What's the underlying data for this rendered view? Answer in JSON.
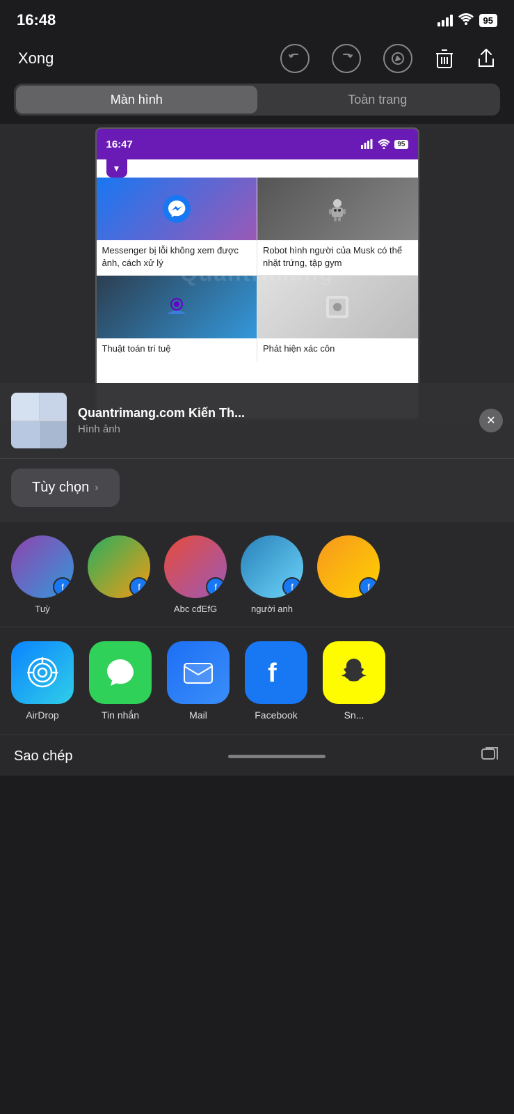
{
  "statusBar": {
    "time": "16:48",
    "batteryLevel": "95"
  },
  "toolbar": {
    "doneLabel": "Xong",
    "undoIcon": "↩",
    "redoIcon": "↪",
    "penIcon": "✏",
    "trashIcon": "🗑",
    "shareIcon": "⬆"
  },
  "segmentControl": {
    "option1": "Màn hình",
    "option2": "Toàn trang"
  },
  "screenshotPreview": {
    "innerTime": "16:47",
    "batteryInner": "95",
    "watermark": "Quantrimang"
  },
  "newsCards": [
    {
      "title": "Messenger bị lỗi không xem được ảnh, cách xử lý",
      "thumb": "messenger"
    },
    {
      "title": "Robot hình người của Musk có thể nhặt trứng, tập gym",
      "thumb": "robot"
    },
    {
      "title": "Thuật toán trí tuệ",
      "thumb": "ai"
    },
    {
      "title": "Phát hiện xác côn",
      "thumb": "detect"
    }
  ],
  "shareSheet": {
    "title": "Quantrimang.com Kiến Th...",
    "subtitle": "Hình ảnh",
    "optionsLabel": "Tùy chọn",
    "optionsChevron": "›"
  },
  "contacts": [
    {
      "name": "Tuỳ",
      "avatarClass": "avatar-1"
    },
    {
      "name": "",
      "avatarClass": "avatar-2"
    },
    {
      "name": "Abc cđEfG",
      "avatarClass": "avatar-3"
    },
    {
      "name": "người anh",
      "avatarClass": "avatar-4"
    },
    {
      "name": "",
      "avatarClass": "avatar-5"
    }
  ],
  "apps": [
    {
      "name": "AirDrop",
      "iconClass": "app-airdrop",
      "symbol": "◎"
    },
    {
      "name": "Tin nhắn",
      "iconClass": "app-messages",
      "symbol": "💬"
    },
    {
      "name": "Mail",
      "iconClass": "app-mail",
      "symbol": "✉"
    },
    {
      "name": "Facebook",
      "iconClass": "app-facebook",
      "symbol": "f"
    },
    {
      "name": "Sn...",
      "iconClass": "app-snapchat",
      "symbol": "👻"
    }
  ],
  "bottomBar": {
    "copyLabel": "Sao chép"
  }
}
